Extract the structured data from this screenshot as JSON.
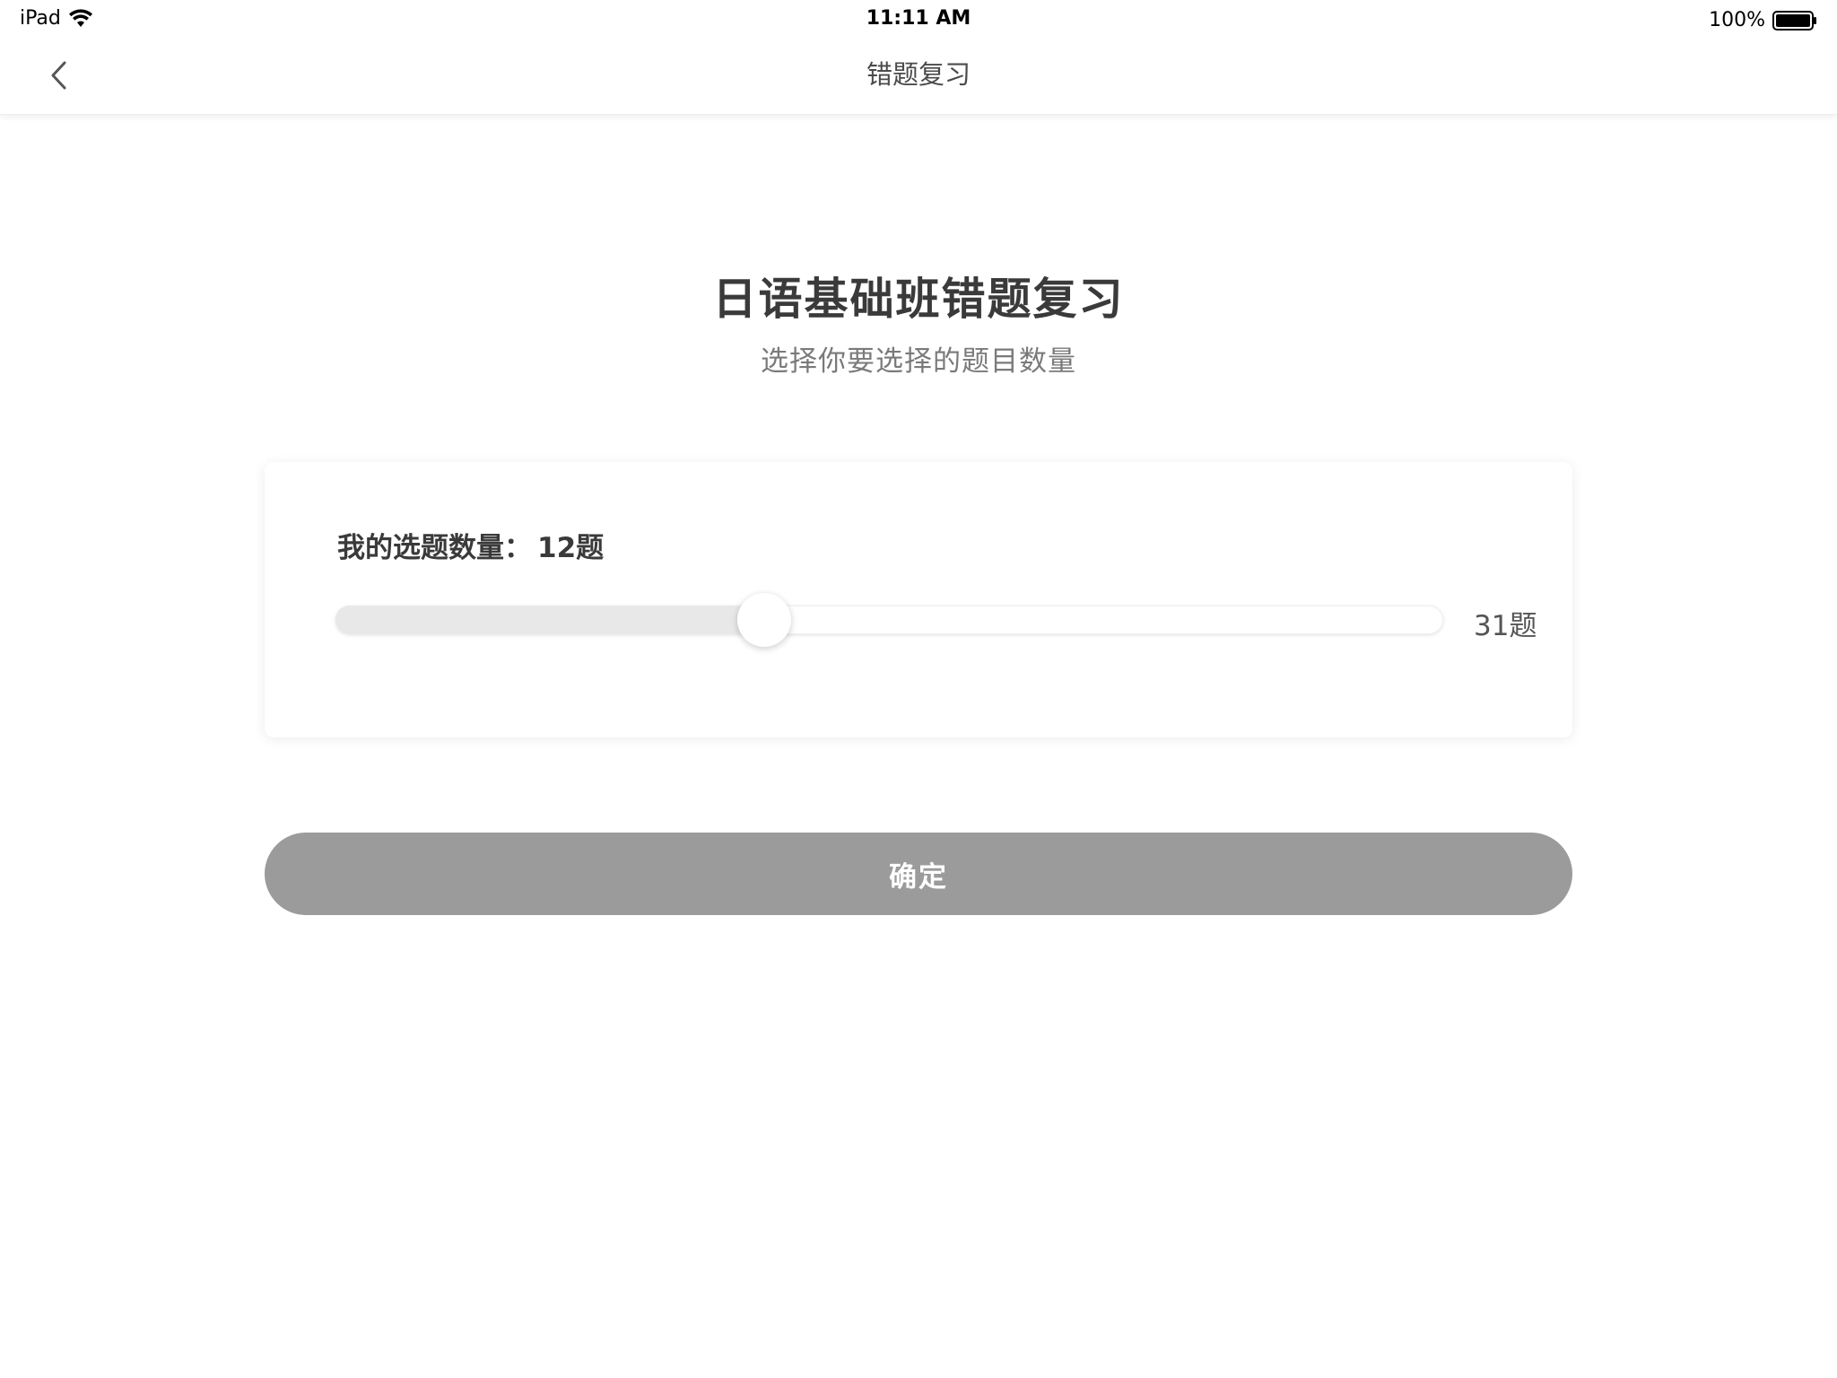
{
  "status_bar": {
    "device": "iPad",
    "time": "11:11 AM",
    "battery": "100%"
  },
  "nav": {
    "title": "错题复习"
  },
  "header": {
    "title": "日语基础班错题复习",
    "subtitle": "选择你要选择的题目数量"
  },
  "selector": {
    "label": "我的选题数量：",
    "selected_value": "12题",
    "max_label": "31题",
    "current": 12,
    "max": 31
  },
  "confirm_button": {
    "label": "确定"
  },
  "colors": {
    "button_bg": "#9b9b9b",
    "slider_fill": "#e8e8e8",
    "title": "#3a3a3a",
    "subtitle": "#7a7a7a"
  }
}
